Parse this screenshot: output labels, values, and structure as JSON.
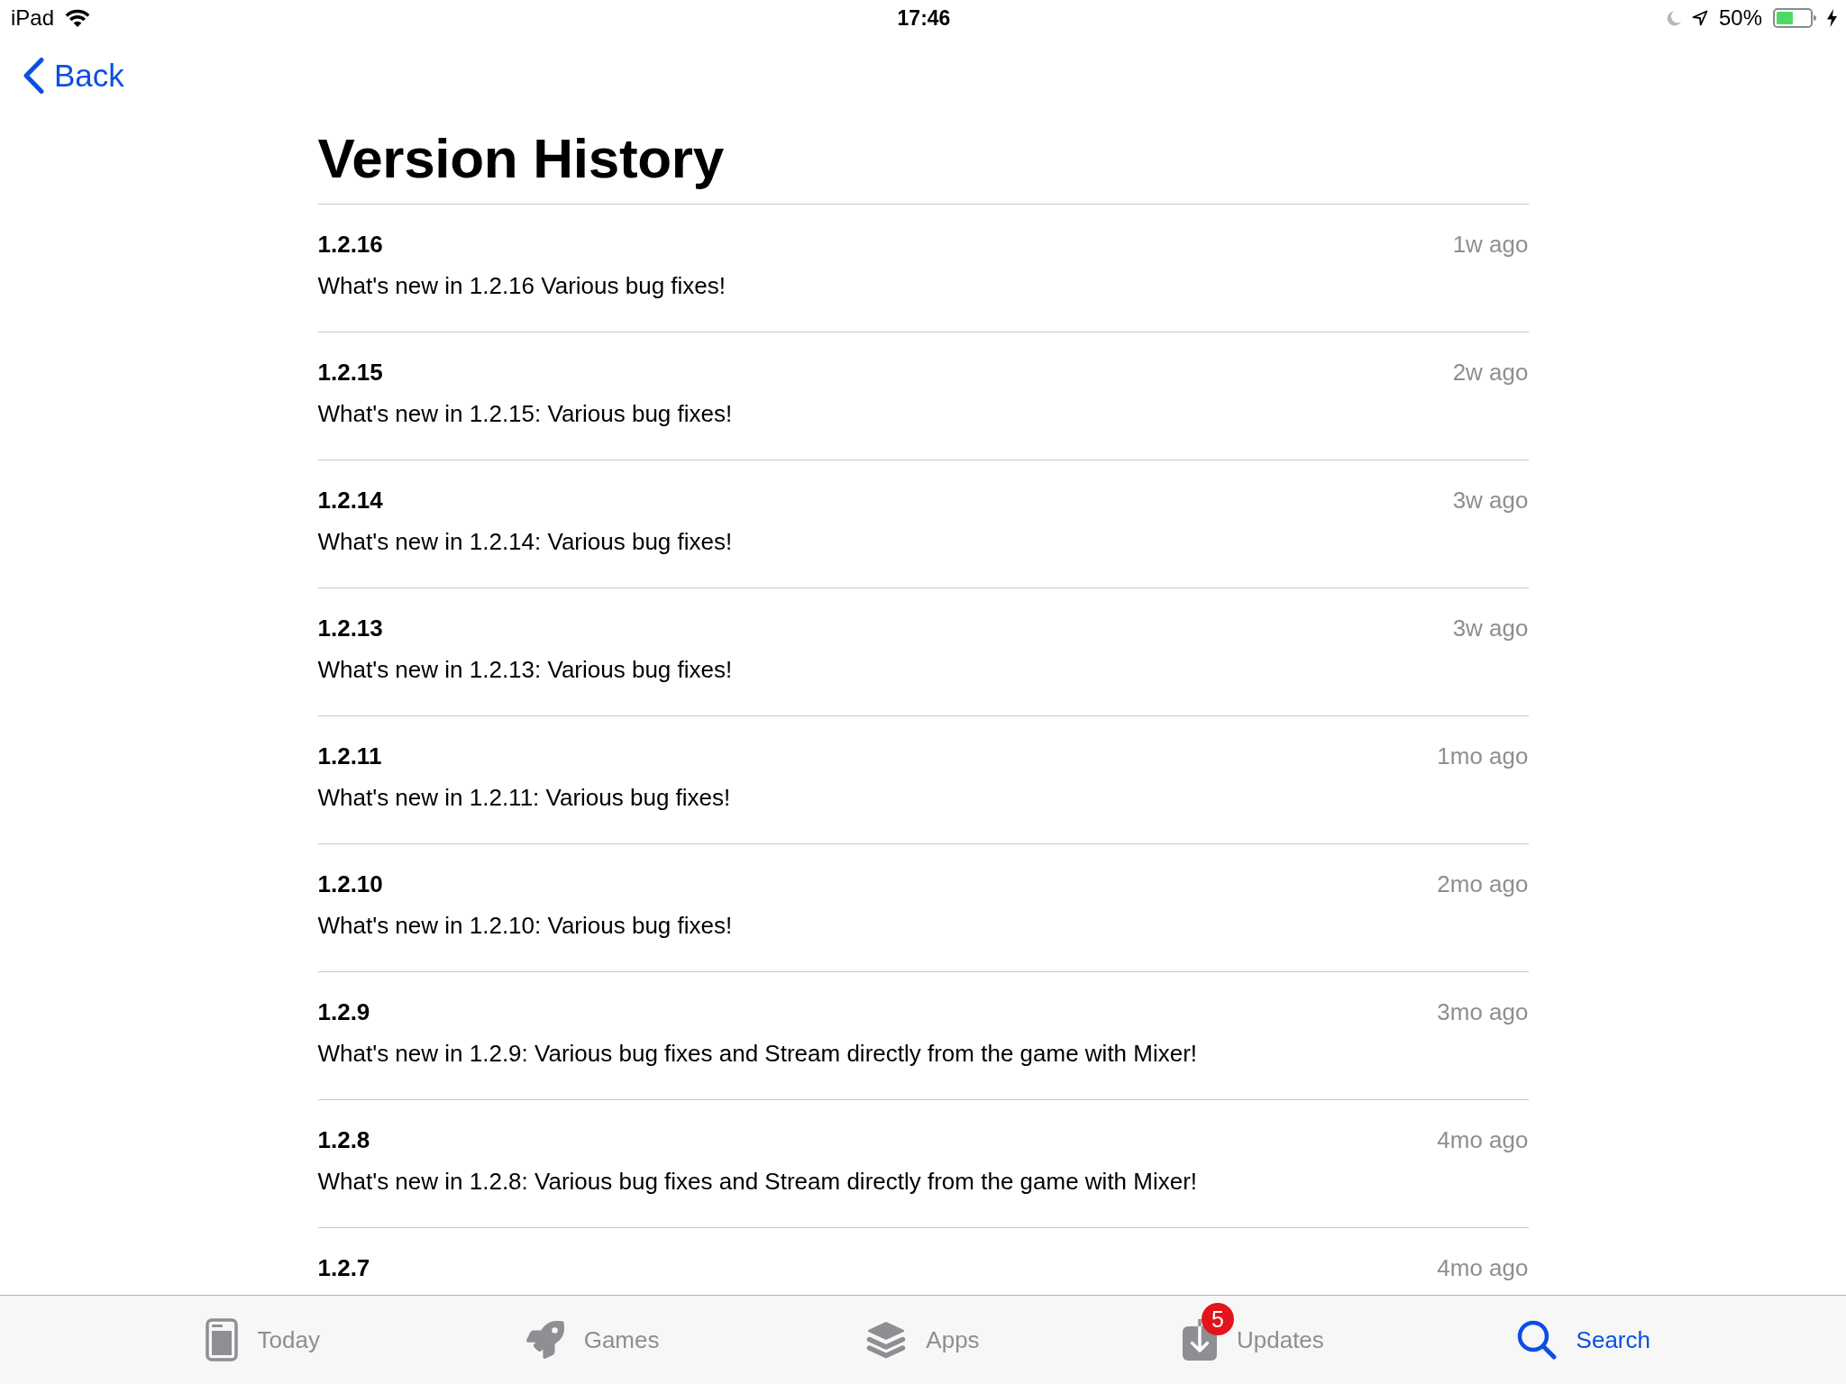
{
  "status_bar": {
    "carrier": "iPad",
    "time": "17:46",
    "battery": "50%"
  },
  "navigation": {
    "back": "Back"
  },
  "title": "Version History",
  "versions": [
    {
      "version": "1.2.16",
      "date": "1w ago",
      "notes": "What's new in 1.2.16 Various bug fixes!"
    },
    {
      "version": "1.2.15",
      "date": "2w ago",
      "notes": "What's new in 1.2.15: Various bug fixes!"
    },
    {
      "version": "1.2.14",
      "date": "3w ago",
      "notes": "What's new in 1.2.14: Various bug fixes!"
    },
    {
      "version": "1.2.13",
      "date": "3w ago",
      "notes": "What's new in 1.2.13: Various bug fixes!"
    },
    {
      "version": "1.2.11",
      "date": "1mo ago",
      "notes": "What's new in 1.2.11: Various bug fixes!"
    },
    {
      "version": "1.2.10",
      "date": "2mo ago",
      "notes": "What's new in 1.2.10: Various bug fixes!"
    },
    {
      "version": "1.2.9",
      "date": "3mo ago",
      "notes": "What's new in 1.2.9: Various bug fixes and Stream directly from the game with Mixer!"
    },
    {
      "version": "1.2.8",
      "date": "4mo ago",
      "notes": "What's new in 1.2.8: Various bug fixes and Stream directly from the game with Mixer!"
    },
    {
      "version": "1.2.7",
      "date": "4mo ago"
    }
  ],
  "tab_bar": [
    {
      "label": "Today",
      "selected": false
    },
    {
      "label": "Games",
      "selected": false
    },
    {
      "label": "Apps",
      "selected": false
    },
    {
      "label": "Updates",
      "selected": false,
      "badge": "5"
    },
    {
      "label": "Search",
      "selected": true
    }
  ]
}
